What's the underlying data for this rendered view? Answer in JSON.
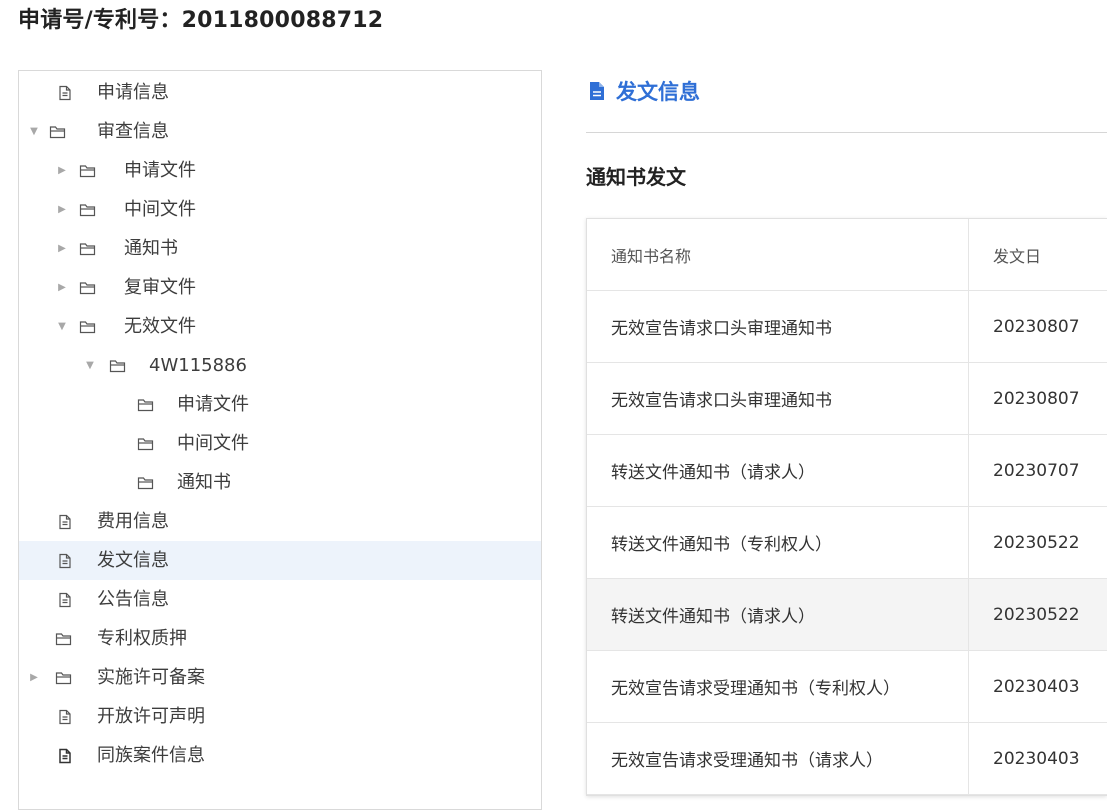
{
  "header": {
    "title": "申请号/专利号：2011800088712"
  },
  "tree": {
    "items": [
      {
        "label": "申请信息",
        "icon": "document-icon",
        "caret": ""
      },
      {
        "label": "审查信息",
        "icon": "folder-icon",
        "caret": "▼"
      },
      {
        "label": "申请文件",
        "icon": "folder-icon",
        "caret": "▶"
      },
      {
        "label": "中间文件",
        "icon": "folder-icon",
        "caret": "▶"
      },
      {
        "label": "通知书",
        "icon": "folder-icon",
        "caret": "▶"
      },
      {
        "label": "复审文件",
        "icon": "folder-icon",
        "caret": "▶"
      },
      {
        "label": "无效文件",
        "icon": "folder-icon",
        "caret": "▼"
      },
      {
        "label": "4W115886",
        "icon": "folder-icon",
        "caret": "▼"
      },
      {
        "label": "申请文件",
        "icon": "folder-icon",
        "caret": ""
      },
      {
        "label": "中间文件",
        "icon": "folder-icon",
        "caret": ""
      },
      {
        "label": "通知书",
        "icon": "folder-icon",
        "caret": ""
      },
      {
        "label": "费用信息",
        "icon": "document-icon",
        "caret": ""
      },
      {
        "label": "发文信息",
        "icon": "document-icon",
        "caret": ""
      },
      {
        "label": "公告信息",
        "icon": "document-icon",
        "caret": ""
      },
      {
        "label": "专利权质押",
        "icon": "folder-icon",
        "caret": ""
      },
      {
        "label": "实施许可备案",
        "icon": "folder-icon",
        "caret": "▶"
      },
      {
        "label": "开放许可声明",
        "icon": "document-icon",
        "caret": ""
      },
      {
        "label": "同族案件信息",
        "icon": "document-icon",
        "caret": ""
      }
    ]
  },
  "main": {
    "section_title": "发文信息",
    "sub_title": "通知书发文",
    "table": {
      "columns": [
        "通知书名称",
        "发文日"
      ],
      "rows": [
        [
          "无效宣告请求口头审理通知书",
          "20230807"
        ],
        [
          "无效宣告请求口头审理通知书",
          "20230807"
        ],
        [
          "转送文件通知书（请求人）",
          "20230707"
        ],
        [
          "转送文件通知书（专利权人）",
          "20230522"
        ],
        [
          "转送文件通知书（请求人）",
          "20230522"
        ],
        [
          "无效宣告请求受理通知书（专利权人）",
          "20230403"
        ],
        [
          "无效宣告请求受理通知书（请求人）",
          "20230403"
        ]
      ]
    }
  },
  "colors": {
    "accent": "#2f6fd6",
    "selected_bg": "#edf3fb",
    "hover_row_bg": "#f4f4f4"
  }
}
